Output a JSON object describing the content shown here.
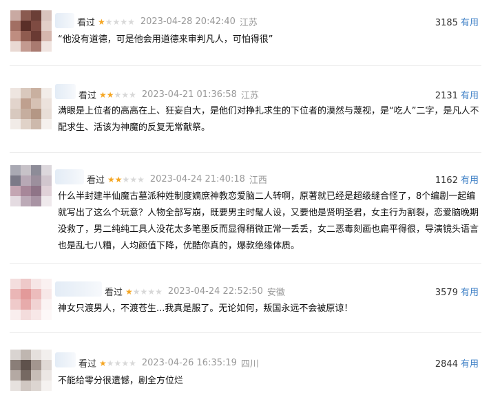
{
  "watched_label": "看过",
  "useful_label": "有用",
  "comments": [
    {
      "stars": 1,
      "time": "2023-04-28 20:42:40",
      "location": "江苏",
      "votes": "3185",
      "text": "“他没有道德，可是他会用道德来审判凡人，可怕得很”"
    },
    {
      "stars": 2,
      "time": "2023-04-21 01:36:58",
      "location": "江苏",
      "votes": "2131",
      "text": "满眼是上位者的高高在上、狂妄自大，是他们对挣扎求生的下位者的漠然与蔑视，是“吃人”二字，是凡人不配求生、活该为神魔的反复无常献祭。"
    },
    {
      "stars": 2,
      "time": "2023-04-24 21:40:18",
      "location": "江西",
      "votes": "1162",
      "text": "什么半封建半仙魔古墓派种姓制度嫡庶神教恋爱脑二人转啊，原著就已经是超级缝合怪了，8个编剧一起编就写出了这么个玩意？人物全部写崩，既要男主时髦人设，又要他是贤明圣君，女主行为割裂，恋爱脑晚期没救了，男二纯纯工具人没花太多笔墨反而显得稍微正常一丢丢，女二恶毒刻画也扁平得很，导演镜头语言也是乱七八糟，人均颜值下降，优酷你真的，爆款绝缘体质。"
    },
    {
      "stars": 1,
      "time": "2023-04-24 22:52:50",
      "location": "安徽",
      "votes": "3579",
      "text": "神女只渡男人，不渡苍生...我真是服了。无论如何，叛国永远不会被原谅！"
    },
    {
      "stars": 1,
      "time": "2023-04-26 16:35:19",
      "location": "四川",
      "votes": "2844",
      "text": "不能给零分很遗憾，剧全方位烂"
    }
  ]
}
